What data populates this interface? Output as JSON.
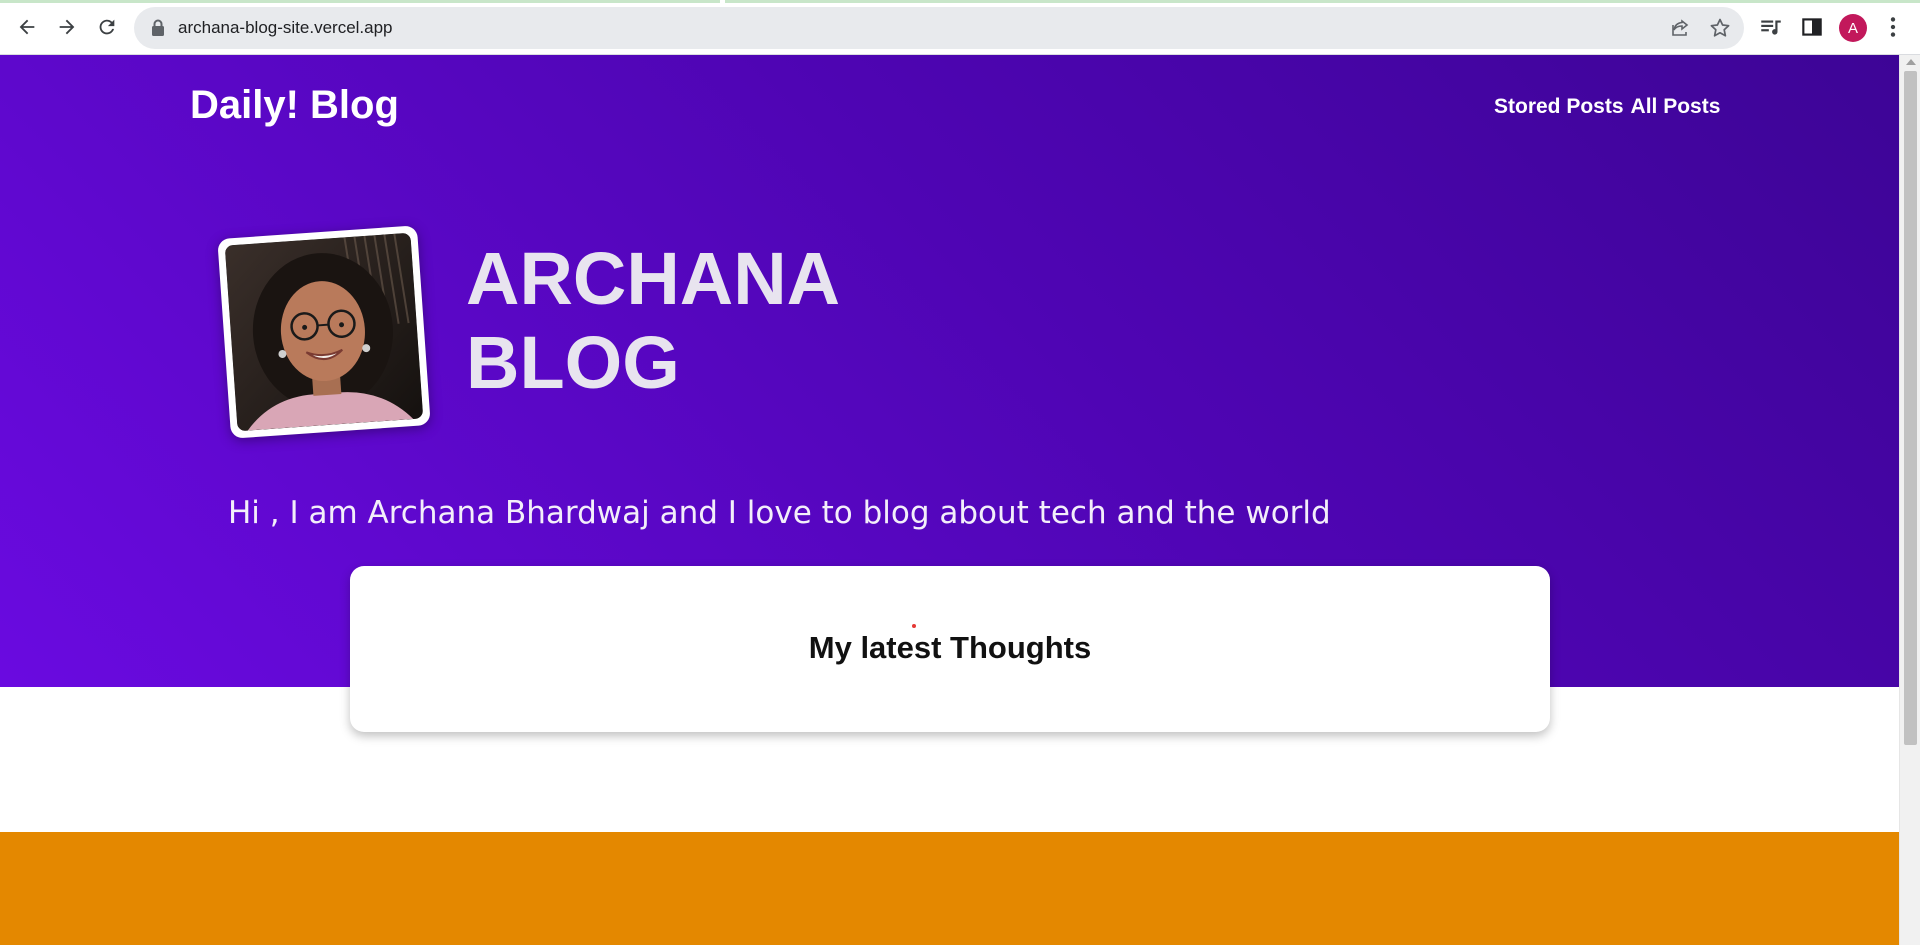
{
  "browser": {
    "url": "archana-blog-site.vercel.app",
    "profile_initial": "A",
    "icons": [
      "back-icon",
      "forward-icon",
      "reload-icon",
      "lock-icon",
      "share-icon",
      "star-icon",
      "media-icon",
      "sidepanel-icon",
      "menu-icon"
    ]
  },
  "site": {
    "title": "Daily! Blog",
    "nav": {
      "stored_posts": "Stored Posts",
      "all_posts": "All Posts"
    }
  },
  "hero": {
    "heading_line1": "ARCHANA",
    "heading_line2": "BLOG",
    "intro": "Hi , I am Archana Bhardwaj and I love to blog about tech and the world"
  },
  "latest": {
    "title": "My latest Thoughts"
  },
  "colors": {
    "hero_gradient_start": "#6a0ae0",
    "hero_gradient_end": "#3d0596",
    "footer_band": "#e48800",
    "avatar": "#c2185b"
  }
}
